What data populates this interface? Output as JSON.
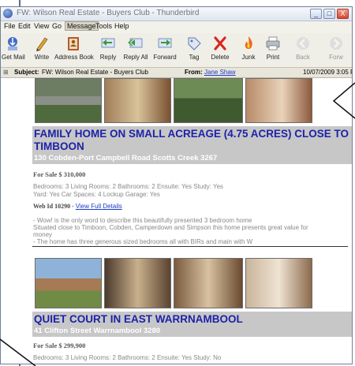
{
  "window": {
    "title": "FW: Wilson Real Estate - Buyers Club - Thunderbird",
    "min": "_",
    "max": "□",
    "close": "X"
  },
  "menu": [
    "File",
    "Edit",
    "View",
    "Go",
    "Message",
    "Tools",
    "Help"
  ],
  "toolbar": {
    "buttons": [
      "Get Mail",
      "Write",
      "Address Book",
      "Reply",
      "Reply All",
      "Forward",
      "Tag",
      "Delete",
      "Junk",
      "Print",
      "Back",
      "Forw"
    ]
  },
  "header": {
    "subject_label": "Subject:",
    "subject_value": "FW: Wilson Real Estate - Buyers Club",
    "from_label": "From:",
    "from_value": "Jane Shaw",
    "date": "10/07/2009 3:05 PM"
  },
  "listing1": {
    "headline": "FAMILY HOME ON SMALL ACREAGE (4.75 ACRES) CLOSE TO TIMBOON",
    "address": "130 Cobden-Port Campbell Road Scotts Creek 3267",
    "price": "For Sale $ 310,000",
    "features1": "Bedrooms: 3   Living Rooms: 2   Bathrooms: 2   Ensuite: Yes   Study: Yes",
    "features2": "Yard: Yes   Car Spaces: 4   Lockup Garage: Yes",
    "web_id": "Web Id 10290 -",
    "details_link": "View Full Details",
    "desc1": "- Wow! is the only word to describe this beautifully presented 3 bedroom home",
    "desc2": "Situated close to Timboon, Cobden, Camperdown and Simpson this home presents great value for",
    "desc3": "money",
    "desc4": "- The home has three generous sized bedrooms all with BIRs and main with W"
  },
  "listing2": {
    "headline": "QUIET COURT IN EAST WARRNAMBOOL",
    "address": "41 Clifton Street Warrnambool 3280",
    "price": "For Sale $ 299,900",
    "features1": "Bedrooms: 3   Living Rooms: 2   Bathrooms: 2   Ensuite: Yes   Study: No"
  }
}
